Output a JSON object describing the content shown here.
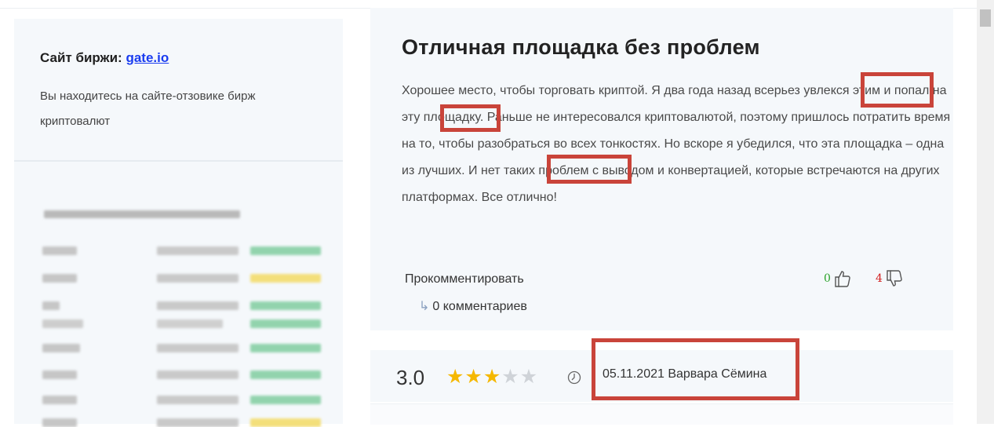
{
  "sidebar": {
    "site_label": "Сайт биржи:",
    "site_link": "gate.io",
    "description": "Вы находитесь на сайте-отзовике бирж криптовалют"
  },
  "review": {
    "title": "Отличная площадка без проблем",
    "text": "Хорошее место, чтобы торговать криптой. Я два года назад всерьез увлекся этим и попал на эту площадку. Раньше не интересовался криптовалютой, поэтому пришлось потратить время на то, чтобы разобраться во всех тонкостях. Но вскоре я убедился, что эта площадка – одна из лучших. И нет таких проблем с выводом и конвертацией, которые встречаются на других платформах. Все отлично!",
    "comment_label": "Прокомментировать",
    "comments_count": "0 комментариев",
    "likes": "0",
    "dislikes": "4"
  },
  "rating": {
    "score": "3.0",
    "stars_filled": 3,
    "stars_total": 5,
    "meta": "05.11.2021 Варвара Сёмина"
  },
  "icons": {
    "like": "thumbs-up-icon",
    "dislike": "thumbs-down-icon",
    "clock": "clock-icon",
    "reply_arrow": "reply-arrow-icon"
  },
  "colors": {
    "link": "#1a3cf0",
    "star": "#f5b800",
    "annotation": "#c9443a",
    "like": "#2aa32a",
    "dislike": "#d21d1d"
  }
}
